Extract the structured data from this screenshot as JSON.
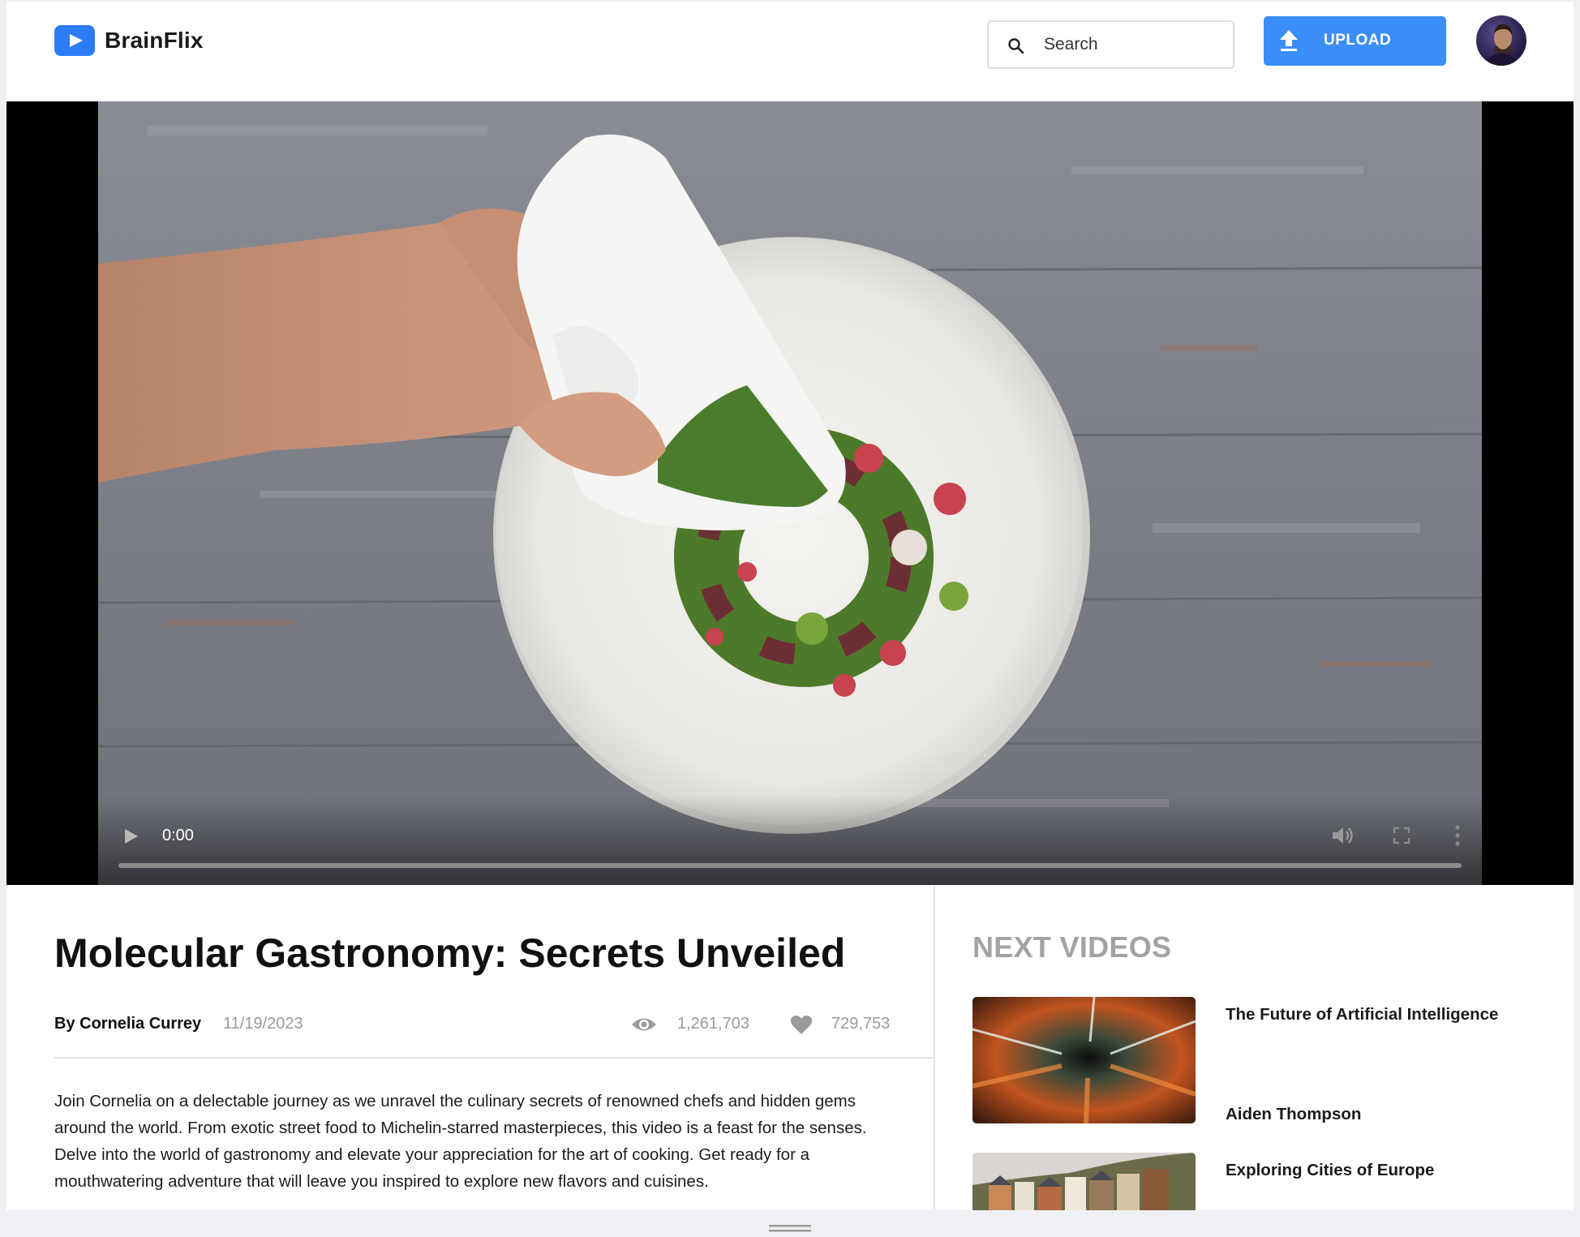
{
  "header": {
    "brand": "BrainFlix",
    "search": {
      "placeholder": "Search",
      "value": ""
    },
    "upload_label": "UPLOAD",
    "accent": "#3b8ef8"
  },
  "player": {
    "time": "0:00",
    "progress": 0,
    "controls": [
      "play-icon",
      "volume-icon",
      "fullscreen-icon",
      "more-vert-icon"
    ]
  },
  "video": {
    "title": "Molecular Gastronomy: Secrets Unveiled",
    "author": "By Cornelia Currey",
    "date": "11/19/2023",
    "views": "1,261,703",
    "likes": "729,753",
    "description": "Join Cornelia on a delectable journey as we unravel the culinary secrets of renowned chefs and hidden gems around the world. From exotic street food to Michelin-starred masterpieces, this video is a feast for the senses. Delve into the world of gastronomy and elevate your appreciation for the art of cooking. Get ready for a mouthwatering adventure that will leave you inspired to explore new flavors and cuisines."
  },
  "next_videos": {
    "heading": "NEXT VIDEOS",
    "items": [
      {
        "title": "The Future of Artificial Intelligence",
        "author": "Aiden Thompson"
      },
      {
        "title": "Exploring Cities of Europe",
        "author": ""
      }
    ]
  }
}
